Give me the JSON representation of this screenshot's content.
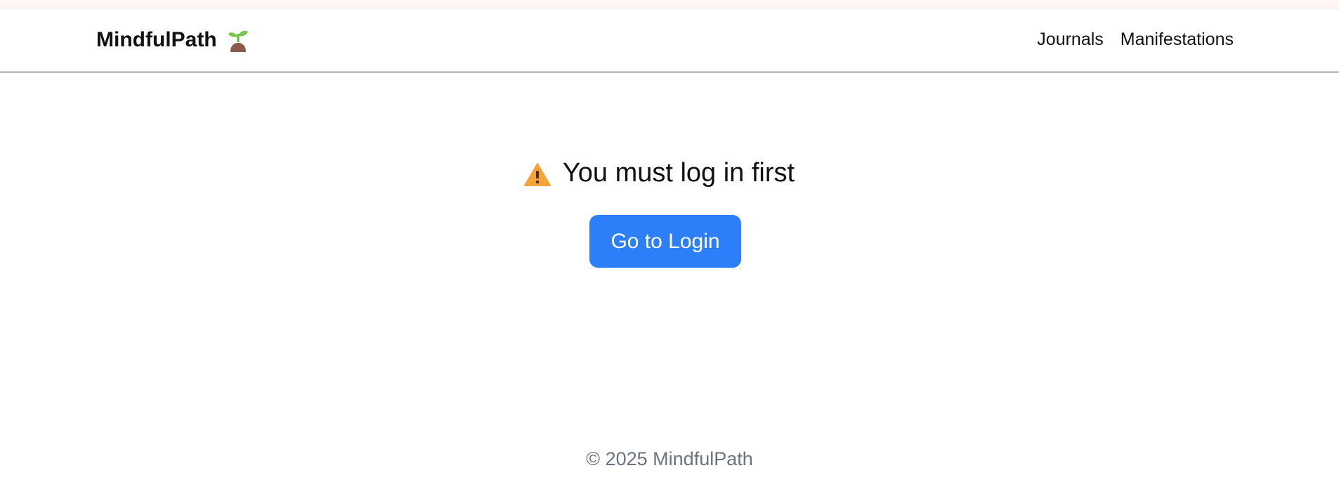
{
  "navbar": {
    "brand": "MindfulPath",
    "brand_icon": "sprout-icon",
    "links": [
      "Journals",
      "Manifestations"
    ]
  },
  "main": {
    "warning_icon": "warning-icon",
    "message": "You must log in first",
    "button_label": "Go to Login"
  },
  "footer": {
    "text": "© 2025 MindfulPath"
  },
  "colors": {
    "button": "#2d7ff9",
    "button_text": "#ffffff",
    "warning": "#f6a43a",
    "footer_text": "#6b7280",
    "top_strip": "#fff5f5"
  }
}
